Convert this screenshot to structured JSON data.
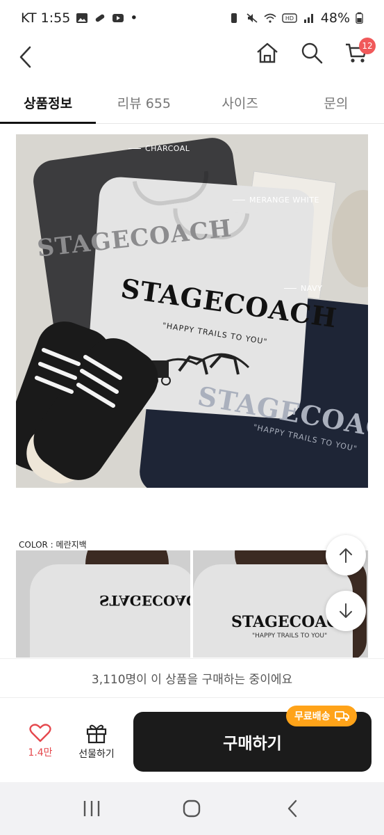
{
  "status_bar": {
    "carrier_time": "KT 1:55",
    "dot": "•",
    "battery": "48%",
    "icons": [
      "gallery-icon",
      "pill-icon",
      "youtube-icon",
      "battery-saver-icon",
      "mute-icon",
      "wifi-icon",
      "hd-icon",
      "signal-icon",
      "battery-icon"
    ]
  },
  "nav": {
    "cart_badge": "12",
    "icons": [
      "back-icon",
      "home-icon",
      "search-icon",
      "cart-icon"
    ]
  },
  "tabs": [
    {
      "label": "상품정보",
      "active": true
    },
    {
      "label": "리뷰 655",
      "active": false
    },
    {
      "label": "사이즈",
      "active": false
    },
    {
      "label": "문의",
      "active": false
    }
  ],
  "main_photo": {
    "tag_charcoal": "CHARCOAL",
    "tag_white": "MERANGE WHITE",
    "tag_navy": "NAVY",
    "print_main": "STAGECOACH",
    "print_sub": "\"HAPPY TRAILS TO YOU\""
  },
  "section2": {
    "color_label": "COLOR : 메란지백",
    "print_main": "STAGECOACH",
    "print_sub": "\"HAPPY TRAILS TO YOU\""
  },
  "notice": "3,110명이 이 상품을 구매하는 중이에요",
  "action_bar": {
    "wish_count": "1.4만",
    "gift_label": "선물하기",
    "buy_label": "구매하기",
    "free_shipping": "무료배송"
  },
  "colors": {
    "accent_red": "#e5484d",
    "badge_red": "#f0595a",
    "buy_button": "#1b1b1b",
    "free_shipping": "#ffa319"
  }
}
